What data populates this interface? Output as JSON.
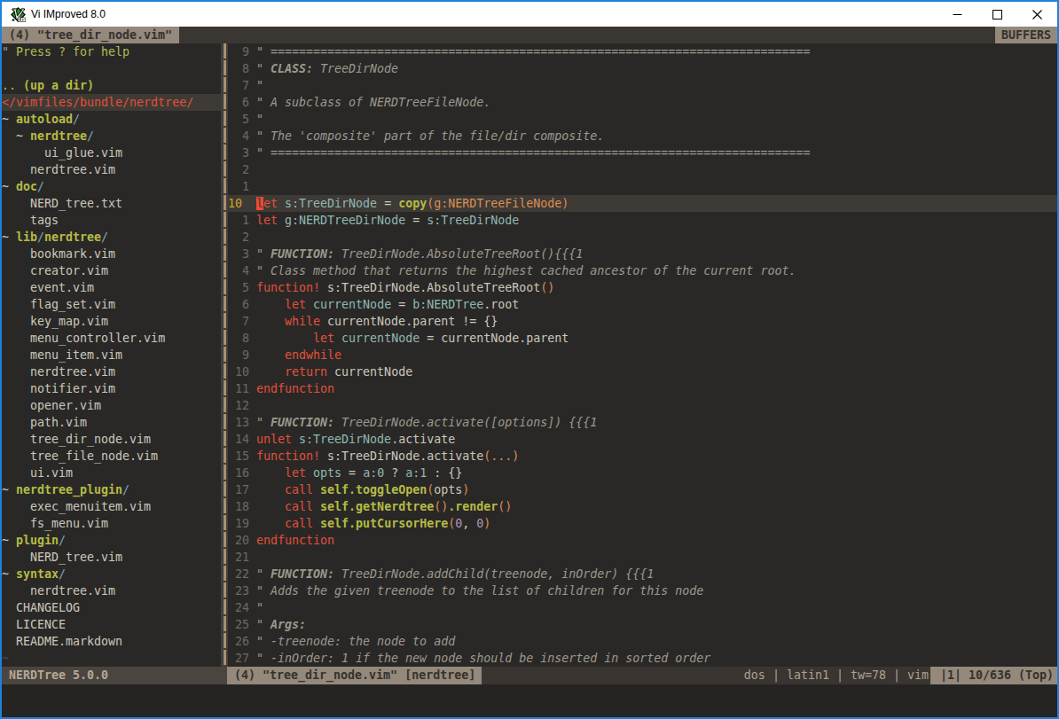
{
  "window": {
    "title": "Vi IMproved 8.0"
  },
  "tabline": {
    "active_tab": "(4) \"tree_dir_node.vim\"",
    "right_label": "BUFFERS"
  },
  "nerdtree": {
    "lines": [
      {
        "spans": [
          [
            "\" ",
            "q"
          ],
          [
            "Press ? for help",
            "h"
          ]
        ]
      },
      {
        "spans": []
      },
      {
        "spans": [
          [
            ".. ",
            "h"
          ],
          [
            "(up a dir)",
            "d"
          ]
        ]
      },
      {
        "root": true,
        "spans": [
          [
            "</vimfiles/bundle/nerdtree/",
            "rt"
          ]
        ]
      },
      {
        "spans": [
          [
            "~ ",
            "n"
          ],
          [
            "autoload",
            "d"
          ],
          [
            "/",
            "s"
          ]
        ]
      },
      {
        "spans": [
          [
            "  ~ ",
            "n"
          ],
          [
            "nerdtree",
            "d"
          ],
          [
            "/",
            "s"
          ]
        ]
      },
      {
        "spans": [
          [
            "      ",
            "n"
          ],
          [
            "ui_glue.vim",
            "f"
          ]
        ]
      },
      {
        "spans": [
          [
            "    ",
            "n"
          ],
          [
            "nerdtree.vim",
            "f"
          ]
        ]
      },
      {
        "spans": [
          [
            "~ ",
            "n"
          ],
          [
            "doc",
            "d"
          ],
          [
            "/",
            "s"
          ]
        ]
      },
      {
        "spans": [
          [
            "    ",
            "n"
          ],
          [
            "NERD_tree.txt",
            "f"
          ]
        ]
      },
      {
        "spans": [
          [
            "    ",
            "n"
          ],
          [
            "tags",
            "f"
          ]
        ]
      },
      {
        "spans": [
          [
            "~ ",
            "n"
          ],
          [
            "lib",
            "d"
          ],
          [
            "/",
            "s"
          ],
          [
            "nerdtree",
            "d"
          ],
          [
            "/",
            "s"
          ]
        ]
      },
      {
        "spans": [
          [
            "    ",
            "n"
          ],
          [
            "bookmark.vim",
            "f"
          ]
        ]
      },
      {
        "spans": [
          [
            "    ",
            "n"
          ],
          [
            "creator.vim",
            "f"
          ]
        ]
      },
      {
        "spans": [
          [
            "    ",
            "n"
          ],
          [
            "event.vim",
            "f"
          ]
        ]
      },
      {
        "spans": [
          [
            "    ",
            "n"
          ],
          [
            "flag_set.vim",
            "f"
          ]
        ]
      },
      {
        "spans": [
          [
            "    ",
            "n"
          ],
          [
            "key_map.vim",
            "f"
          ]
        ]
      },
      {
        "spans": [
          [
            "    ",
            "n"
          ],
          [
            "menu_controller.vim",
            "f"
          ]
        ]
      },
      {
        "spans": [
          [
            "    ",
            "n"
          ],
          [
            "menu_item.vim",
            "f"
          ]
        ]
      },
      {
        "spans": [
          [
            "    ",
            "n"
          ],
          [
            "nerdtree.vim",
            "f"
          ]
        ]
      },
      {
        "spans": [
          [
            "    ",
            "n"
          ],
          [
            "notifier.vim",
            "f"
          ]
        ]
      },
      {
        "spans": [
          [
            "    ",
            "n"
          ],
          [
            "opener.vim",
            "f"
          ]
        ]
      },
      {
        "spans": [
          [
            "    ",
            "n"
          ],
          [
            "path.vim",
            "f"
          ]
        ]
      },
      {
        "spans": [
          [
            "    ",
            "n"
          ],
          [
            "tree_dir_node.vim",
            "f"
          ]
        ]
      },
      {
        "spans": [
          [
            "    ",
            "n"
          ],
          [
            "tree_file_node.vim",
            "f"
          ]
        ]
      },
      {
        "spans": [
          [
            "    ",
            "n"
          ],
          [
            "ui.vim",
            "f"
          ]
        ]
      },
      {
        "spans": [
          [
            "~ ",
            "n"
          ],
          [
            "nerdtree_plugin",
            "d"
          ],
          [
            "/",
            "s"
          ]
        ]
      },
      {
        "spans": [
          [
            "    ",
            "n"
          ],
          [
            "exec_menuitem.vim",
            "f"
          ]
        ]
      },
      {
        "spans": [
          [
            "    ",
            "n"
          ],
          [
            "fs_menu.vim",
            "f"
          ]
        ]
      },
      {
        "spans": [
          [
            "~ ",
            "n"
          ],
          [
            "plugin",
            "d"
          ],
          [
            "/",
            "s"
          ]
        ]
      },
      {
        "spans": [
          [
            "    ",
            "n"
          ],
          [
            "NERD_tree.vim",
            "f"
          ]
        ]
      },
      {
        "spans": [
          [
            "~ ",
            "n"
          ],
          [
            "syntax",
            "d"
          ],
          [
            "/",
            "s"
          ]
        ]
      },
      {
        "spans": [
          [
            "    ",
            "n"
          ],
          [
            "nerdtree.vim",
            "f"
          ]
        ]
      },
      {
        "spans": [
          [
            "  ",
            "n"
          ],
          [
            "CHANGELOG",
            "f"
          ]
        ]
      },
      {
        "spans": [
          [
            "  ",
            "n"
          ],
          [
            "LICENCE",
            "f"
          ]
        ]
      },
      {
        "spans": [
          [
            "  ",
            "n"
          ],
          [
            "README.markdown",
            "f"
          ]
        ]
      },
      {
        "spans": [
          [
            "~",
            "dim"
          ]
        ]
      }
    ]
  },
  "editor": {
    "lines": [
      {
        "num": "  9 ",
        "cur": false,
        "spans": [
          [
            "\" ============================================================================",
            "cm"
          ]
        ]
      },
      {
        "num": "  8 ",
        "cur": false,
        "spans": [
          [
            "\" ",
            "cm"
          ],
          [
            "CLASS:",
            "cmb"
          ],
          [
            " TreeDirNode",
            "cm"
          ]
        ]
      },
      {
        "num": "  7 ",
        "cur": false,
        "spans": [
          [
            "\"",
            "cm"
          ]
        ]
      },
      {
        "num": "  6 ",
        "cur": false,
        "spans": [
          [
            "\" A subclass of NERDTreeFileNode.",
            "cm"
          ]
        ]
      },
      {
        "num": "  5 ",
        "cur": false,
        "spans": [
          [
            "\"",
            "cm"
          ]
        ]
      },
      {
        "num": "  4 ",
        "cur": false,
        "spans": [
          [
            "\" The 'composite' part of the file/dir composite.",
            "cm"
          ]
        ]
      },
      {
        "num": "  3 ",
        "cur": false,
        "spans": [
          [
            "\" ============================================================================",
            "cm"
          ]
        ]
      },
      {
        "num": "  2 ",
        "cur": false,
        "spans": []
      },
      {
        "num": "  1 ",
        "cur": false,
        "spans": []
      },
      {
        "num": "10  ",
        "cur": true,
        "spans": [
          [
            "l",
            "cb"
          ],
          [
            "et",
            "r"
          ],
          [
            " ",
            "n"
          ],
          [
            "s:TreeDirNode",
            "cy"
          ],
          [
            " = ",
            "n"
          ],
          [
            "copy",
            "g"
          ],
          [
            "(g:NERDTreeFileNode)",
            "o"
          ]
        ]
      },
      {
        "num": "  1 ",
        "cur": false,
        "spans": [
          [
            "let",
            "r"
          ],
          [
            " ",
            "n"
          ],
          [
            "g:NERDTreeDirNode",
            "cy"
          ],
          [
            " = ",
            "n"
          ],
          [
            "s:TreeDirNode",
            "cy"
          ]
        ]
      },
      {
        "num": "  2 ",
        "cur": false,
        "spans": []
      },
      {
        "num": "  3 ",
        "cur": false,
        "spans": [
          [
            "\" ",
            "cm"
          ],
          [
            "FUNCTION:",
            "cmb"
          ],
          [
            " TreeDirNode.AbsoluteTreeRoot(){{{1",
            "cm"
          ]
        ]
      },
      {
        "num": "  4 ",
        "cur": false,
        "spans": [
          [
            "\" Class method that returns the highest cached ancestor of the current root.",
            "cm"
          ]
        ]
      },
      {
        "num": "  5 ",
        "cur": false,
        "spans": [
          [
            "function!",
            "r"
          ],
          [
            " s:TreeDirNode.AbsoluteTreeRoot",
            "n"
          ],
          [
            "()",
            "o"
          ]
        ]
      },
      {
        "num": "  6 ",
        "cur": false,
        "spans": [
          [
            "    ",
            "n"
          ],
          [
            "let",
            "r"
          ],
          [
            " ",
            "n"
          ],
          [
            "currentNode",
            "cy"
          ],
          [
            " = ",
            "n"
          ],
          [
            "b:NERDTree",
            "cy"
          ],
          [
            ".root",
            "n"
          ]
        ]
      },
      {
        "num": "  7 ",
        "cur": false,
        "spans": [
          [
            "    ",
            "n"
          ],
          [
            "while",
            "r"
          ],
          [
            " currentNode.parent != {}",
            "n"
          ]
        ]
      },
      {
        "num": "  8 ",
        "cur": false,
        "spans": [
          [
            "        ",
            "n"
          ],
          [
            "let",
            "r"
          ],
          [
            " ",
            "n"
          ],
          [
            "currentNode",
            "cy"
          ],
          [
            " = currentNode.parent",
            "n"
          ]
        ]
      },
      {
        "num": "  9 ",
        "cur": false,
        "spans": [
          [
            "    ",
            "n"
          ],
          [
            "endwhile",
            "r"
          ]
        ]
      },
      {
        "num": " 10 ",
        "cur": false,
        "spans": [
          [
            "    ",
            "n"
          ],
          [
            "return",
            "r"
          ],
          [
            " currentNode",
            "n"
          ]
        ]
      },
      {
        "num": " 11 ",
        "cur": false,
        "spans": [
          [
            "endfunction",
            "r"
          ]
        ]
      },
      {
        "num": " 12 ",
        "cur": false,
        "spans": []
      },
      {
        "num": " 13 ",
        "cur": false,
        "spans": [
          [
            "\" ",
            "cm"
          ],
          [
            "FUNCTION:",
            "cmb"
          ],
          [
            " TreeDirNode.activate([options]) {{{1",
            "cm"
          ]
        ]
      },
      {
        "num": " 14 ",
        "cur": false,
        "spans": [
          [
            "unlet",
            "r"
          ],
          [
            " ",
            "n"
          ],
          [
            "s:TreeDirNode",
            "cy"
          ],
          [
            ".activate",
            "n"
          ]
        ]
      },
      {
        "num": " 15 ",
        "cur": false,
        "spans": [
          [
            "function!",
            "r"
          ],
          [
            " s:TreeDirNode.activate",
            "n"
          ],
          [
            "(...)",
            "o"
          ]
        ]
      },
      {
        "num": " 16 ",
        "cur": false,
        "spans": [
          [
            "    ",
            "n"
          ],
          [
            "let",
            "r"
          ],
          [
            " ",
            "n"
          ],
          [
            "opts",
            "cy"
          ],
          [
            " = ",
            "n"
          ],
          [
            "a:0",
            "cy"
          ],
          [
            " ? ",
            "n"
          ],
          [
            "a:1",
            "cy"
          ],
          [
            " : {}",
            "n"
          ]
        ]
      },
      {
        "num": " 17 ",
        "cur": false,
        "spans": [
          [
            "    ",
            "n"
          ],
          [
            "call",
            "r"
          ],
          [
            " ",
            "n"
          ],
          [
            "self.toggleOpen",
            "g"
          ],
          [
            "(",
            "o"
          ],
          [
            "opts",
            "n"
          ],
          [
            ")",
            "o"
          ]
        ]
      },
      {
        "num": " 18 ",
        "cur": false,
        "spans": [
          [
            "    ",
            "n"
          ],
          [
            "call",
            "r"
          ],
          [
            " ",
            "n"
          ],
          [
            "self.getNerdtree",
            "g"
          ],
          [
            "()",
            "o"
          ],
          [
            ".render",
            "g"
          ],
          [
            "()",
            "o"
          ]
        ]
      },
      {
        "num": " 19 ",
        "cur": false,
        "spans": [
          [
            "    ",
            "n"
          ],
          [
            "call",
            "r"
          ],
          [
            " ",
            "n"
          ],
          [
            "self.putCursorHere",
            "g"
          ],
          [
            "(",
            "o"
          ],
          [
            "0",
            "p"
          ],
          [
            ", ",
            "n"
          ],
          [
            "0",
            "p"
          ],
          [
            ")",
            "o"
          ]
        ]
      },
      {
        "num": " 20 ",
        "cur": false,
        "spans": [
          [
            "endfunction",
            "r"
          ]
        ]
      },
      {
        "num": " 21 ",
        "cur": false,
        "spans": []
      },
      {
        "num": " 22 ",
        "cur": false,
        "spans": [
          [
            "\" ",
            "cm"
          ],
          [
            "FUNCTION:",
            "cmb"
          ],
          [
            " TreeDirNode.addChild(treenode, inOrder) {{{1",
            "cm"
          ]
        ]
      },
      {
        "num": " 23 ",
        "cur": false,
        "spans": [
          [
            "\" Adds the given treenode to the list of children for this node",
            "cm"
          ]
        ]
      },
      {
        "num": " 24 ",
        "cur": false,
        "spans": [
          [
            "\"",
            "cm"
          ]
        ]
      },
      {
        "num": " 25 ",
        "cur": false,
        "spans": [
          [
            "\" ",
            "cm"
          ],
          [
            "Args:",
            "cmb"
          ]
        ]
      },
      {
        "num": " 26 ",
        "cur": false,
        "spans": [
          [
            "\" -treenode: the node to add",
            "cm"
          ]
        ]
      },
      {
        "num": " 27 ",
        "cur": false,
        "spans": [
          [
            "\" -inOrder: 1 if the new node should be inserted in sorted order",
            "cm"
          ]
        ]
      }
    ]
  },
  "icons": {
    "app_icon": "vim-diamond-logo",
    "minimize_icon": "─",
    "maximize_icon": "□",
    "close_icon": "✕",
    "vertical_separator_glyph": "│"
  },
  "statusline": {
    "left": "NERDTree 5.0.0",
    "buffer": "(4) \"tree_dir_node.vim\" [nerdtree]",
    "info": "dos | latin1 | tw=78 | vim",
    "position": "|1| 10/636 (Top)"
  },
  "colors": {
    "accent_border": "#1e82dc",
    "titlebar_bg": "#ffffff",
    "titlebar_text": "#000000",
    "editor_bg": "#2a2826",
    "cursorline_bg": "#3e3a35",
    "tabbar_bg": "#3a3631",
    "tab_active_bg": "#94897b",
    "tab_active_text": "#36322d",
    "status_inactive_bg": "#4b4540",
    "status_inactive_text": "#b3a895",
    "status_mid_bg": "#3a3531",
    "status_mid_text": "#aba291",
    "cmdline_bg": "#262422",
    "text": "#cbc7bd",
    "comment": "#9d988e",
    "red": "#e2503c",
    "cursor_bg": "#f04a33",
    "orange": "#dc8e55",
    "green": "#b4bb45",
    "cyan": "#8fb8b2",
    "purple": "#b294bb",
    "slash_blue": "#7ba3c0",
    "help_green": "#b2b955",
    "linenr": "#6e6962",
    "linenr_current": "#d6a426",
    "dim_tilde": "#4e4a44",
    "vsplit_bg": "#443f3a",
    "vsplit_dash": "#8e8375"
  }
}
